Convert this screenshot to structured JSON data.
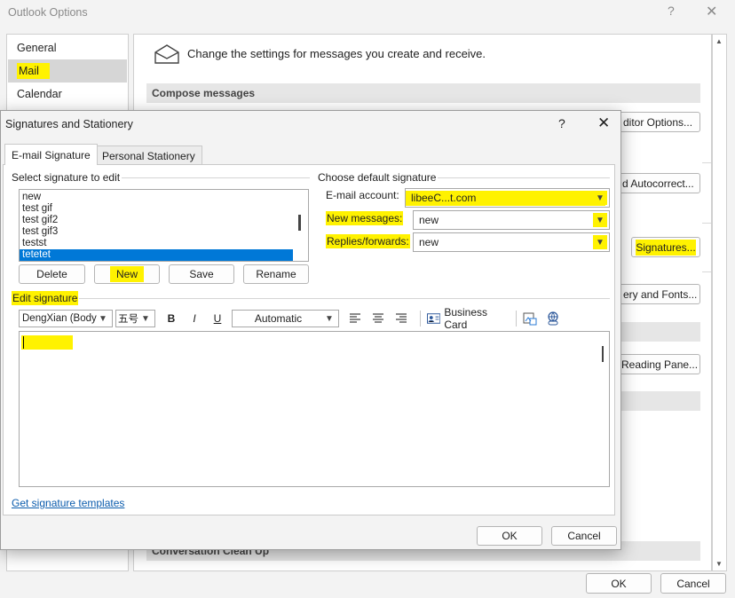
{
  "outlook_options": {
    "title": "Outlook Options",
    "help_glyph": "?",
    "close_glyph": "✕",
    "nav": [
      {
        "label": "General",
        "selected": false
      },
      {
        "label": "Mail",
        "selected": true
      },
      {
        "label": "Calendar",
        "selected": false
      }
    ],
    "header_text": "Change the settings for messages you create and receive.",
    "sections": {
      "compose": "Compose messages",
      "conversation": "Conversation Clean Up"
    },
    "buttons": {
      "editor_options": "ditor Options...",
      "autocorrect": "d Autocorrect...",
      "signatures": "Signatures...",
      "stationery": "ery and Fonts...",
      "reading_pane": "Reading Pane..."
    },
    "ok": "OK",
    "cancel": "Cancel"
  },
  "dialog": {
    "title": "Signatures and Stationery",
    "help_glyph": "?",
    "close_glyph": "✕",
    "tabs": [
      "E-mail Signature",
      "Personal Stationery"
    ],
    "select_label": "Select signature to edit",
    "signatures": [
      "new",
      "test gif",
      "test gif2",
      "test gif3",
      "testst",
      "tetetet"
    ],
    "selected_signature": "tetetet",
    "list_buttons": {
      "delete": "Delete",
      "new": "New",
      "save": "Save",
      "rename": "Rename"
    },
    "default_label": "Choose default signature",
    "email_account_label": "E-mail account:",
    "email_account_value": "libeeC...t.com",
    "new_messages_label": "New messages:",
    "new_messages_value": "new",
    "replies_label": "Replies/forwards:",
    "replies_value": "new",
    "edit_label": "Edit signature",
    "toolbar": {
      "font": "DengXian (Body",
      "size": "五号",
      "bold": "B",
      "italic": "I",
      "underline": "U",
      "color": "Automatic",
      "business_card": "Business Card"
    },
    "templates_link": "Get signature templates",
    "ok": "OK",
    "cancel": "Cancel"
  },
  "colors": {
    "highlight": "#fff200",
    "selection": "#0078d7",
    "link": "#0b5cad"
  }
}
